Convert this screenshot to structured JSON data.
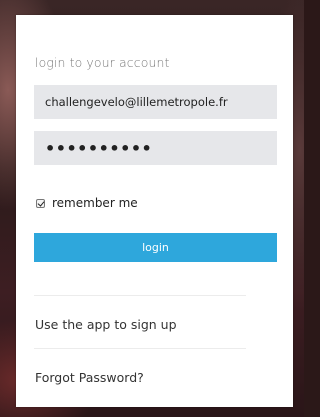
{
  "login": {
    "heading": "login to your account",
    "email_value": "challengevelo@lillemetropole.fr",
    "password_masked": "••••••••••",
    "remember_label": "remember me",
    "remember_checked": true,
    "button_label": "login"
  },
  "links": {
    "signup": "Use the app to sign up",
    "forgot": "Forgot Password?"
  },
  "colors": {
    "accent": "#2ea7dc",
    "field_bg": "#e6e7ea"
  }
}
